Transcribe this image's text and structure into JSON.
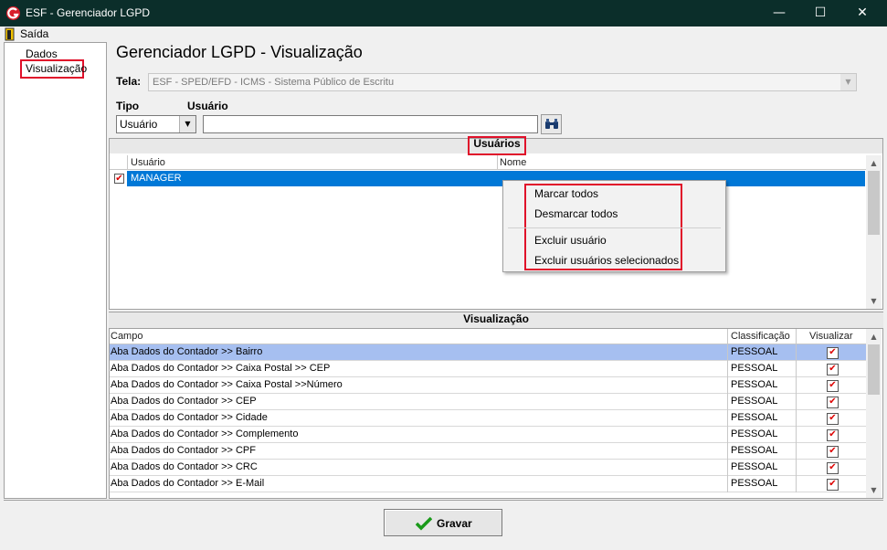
{
  "window": {
    "title": "ESF - Gerenciador LGPD",
    "minimize": "—",
    "maximize": "☐",
    "close": "✕"
  },
  "menu": {
    "exit": "Saída"
  },
  "tree": {
    "items": [
      "Dados",
      "Visualização"
    ]
  },
  "page": {
    "title": "Gerenciador LGPD - Visualização"
  },
  "form": {
    "tela_label": "Tela:",
    "tela_value": "ESF - SPED/EFD - ICMS - Sistema Público de Escritu",
    "tipo_label": "Tipo",
    "tipo_value": "Usuário",
    "usuario_label": "Usuário",
    "usuario_value": ""
  },
  "users_panel": {
    "title": "Usuários",
    "columns": [
      "Usuário",
      "Nome"
    ],
    "rows": [
      {
        "usuario": "MANAGER",
        "nome": "",
        "checked": true
      }
    ]
  },
  "context_menu": {
    "items": [
      "Marcar todos",
      "Desmarcar todos",
      "Excluir usuário",
      "Excluir usuários selecionados"
    ]
  },
  "vis_panel": {
    "title": "Visualização",
    "columns": [
      "Campo",
      "Classificação",
      "Visualizar"
    ],
    "rows": [
      {
        "campo": "Aba Dados do Contador >> Bairro",
        "classificacao": "PESSOAL",
        "visualizar": true
      },
      {
        "campo": "Aba Dados do Contador >> Caixa Postal >> CEP",
        "classificacao": "PESSOAL",
        "visualizar": true
      },
      {
        "campo": "Aba Dados do Contador >> Caixa Postal >>Número",
        "classificacao": "PESSOAL",
        "visualizar": true
      },
      {
        "campo": "Aba Dados do Contador >> CEP",
        "classificacao": "PESSOAL",
        "visualizar": true
      },
      {
        "campo": "Aba Dados do Contador >> Cidade",
        "classificacao": "PESSOAL",
        "visualizar": true
      },
      {
        "campo": "Aba Dados do Contador >> Complemento",
        "classificacao": "PESSOAL",
        "visualizar": true
      },
      {
        "campo": "Aba Dados do Contador >> CPF",
        "classificacao": "PESSOAL",
        "visualizar": true
      },
      {
        "campo": "Aba Dados do Contador >> CRC",
        "classificacao": "PESSOAL",
        "visualizar": true
      },
      {
        "campo": "Aba Dados do Contador >> E-Mail",
        "classificacao": "PESSOAL",
        "visualizar": true
      }
    ]
  },
  "footer": {
    "save_label": "Gravar"
  },
  "colors": {
    "titlebar": "#0b2e2a",
    "selection": "#0078d7",
    "row_highlight": "#a6bff0",
    "highlight_box": "#e0102a"
  },
  "icons": {
    "app": "app-logo-icon",
    "exit": "exit-door-icon",
    "search": "binoculars-icon",
    "save": "checkmark-icon"
  }
}
